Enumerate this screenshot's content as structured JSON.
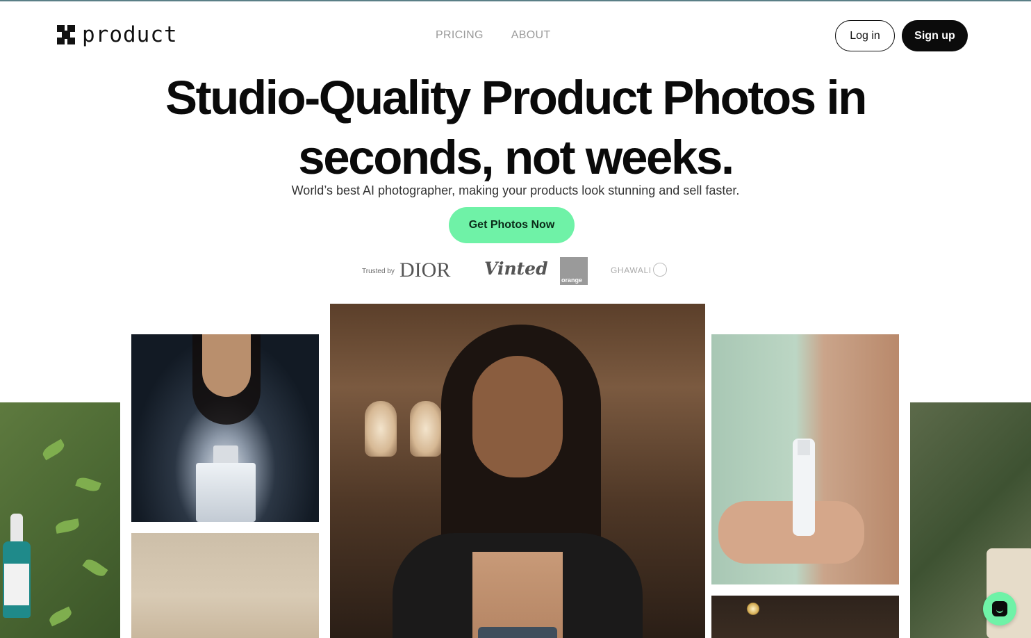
{
  "header": {
    "logo_text": "product",
    "nav": [
      {
        "label": "PRICING"
      },
      {
        "label": "ABOUT"
      }
    ],
    "login_label": "Log in",
    "signup_label": "Sign up"
  },
  "hero": {
    "title_line1": "Studio-Quality Product Photos in",
    "title_line2": "seconds, not weeks.",
    "subtitle": "World’s best AI photographer, making your products look stunning and sell faster.",
    "cta_label": "Get Photos Now"
  },
  "trusted": {
    "label": "Trusted by",
    "brands": {
      "dior": "DIOR",
      "vinted": "Vinted",
      "orange": "orange",
      "ghawali": "GHAWALI"
    }
  },
  "colors": {
    "accent_green": "#6ff2a7",
    "black": "#0b0b0b",
    "nav_grey": "#9a9a9a"
  },
  "icons": {
    "logo": "product-logo-icon",
    "chat": "chat-icon"
  }
}
